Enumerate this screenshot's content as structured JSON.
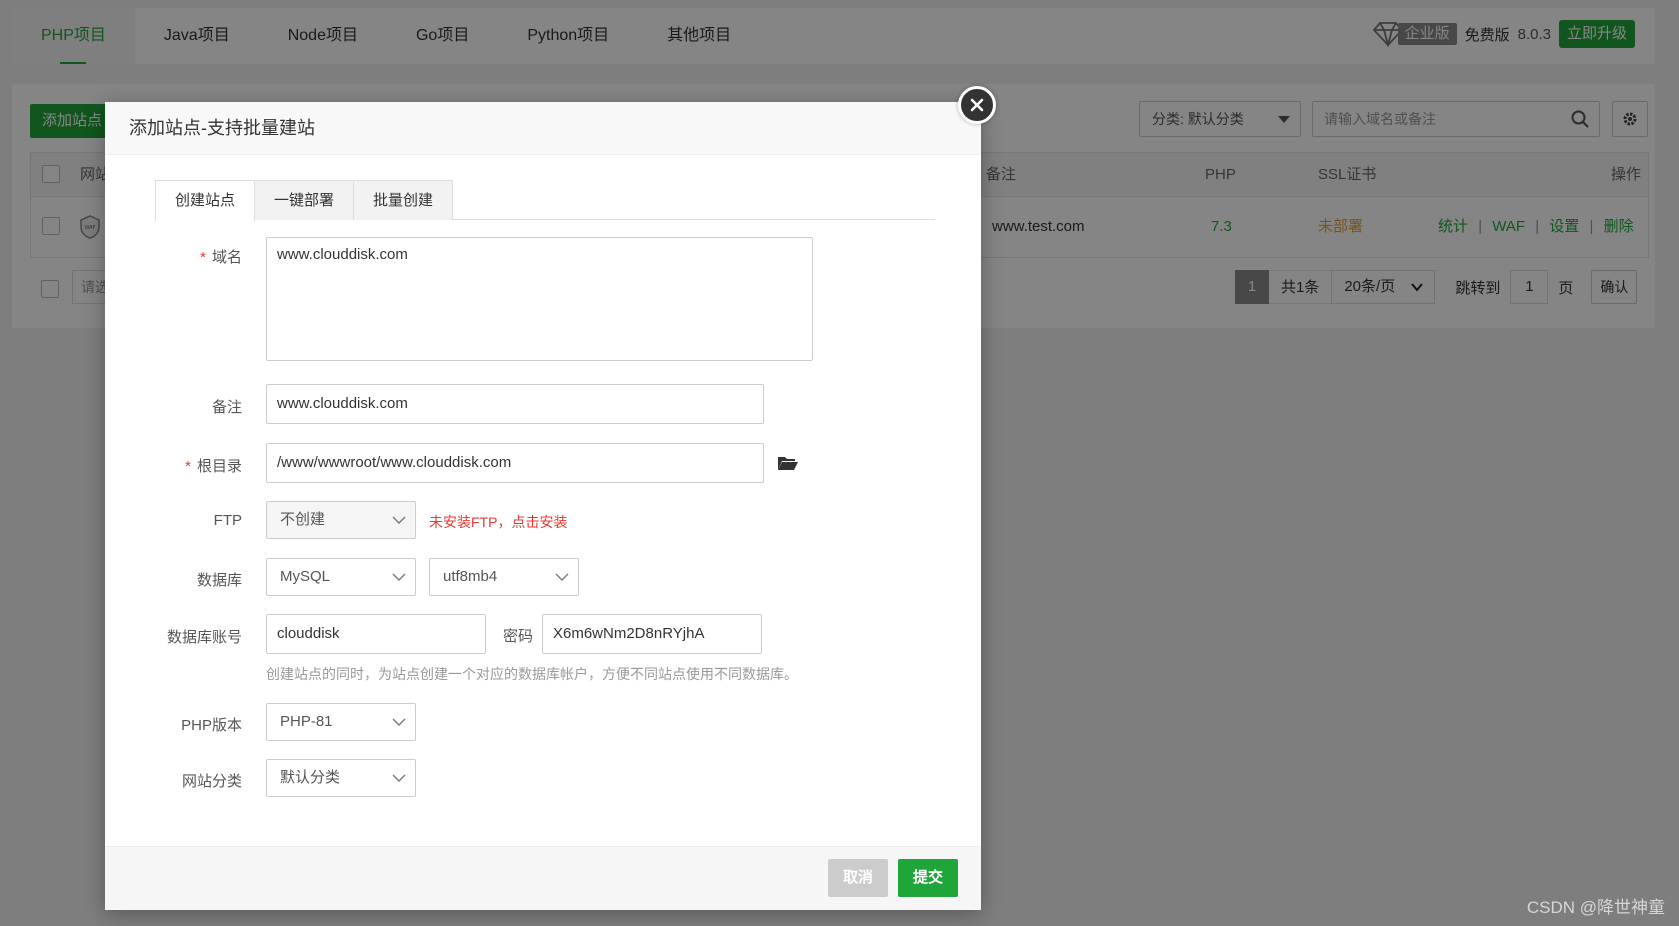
{
  "top_nav": {
    "tabs": [
      "PHP项目",
      "Java项目",
      "Node项目",
      "Go项目",
      "Python项目",
      "其他项目"
    ],
    "active_index": 0,
    "enterprise_label": "企业版",
    "free_label": "免费版",
    "version": "8.0.3",
    "upgrade_label": "立即升级"
  },
  "toolbar": {
    "add_site_label": "添加站点",
    "category_select": "分类: 默认分类",
    "search_placeholder": "请输入域名或备注"
  },
  "table": {
    "headers": {
      "site": "网站",
      "remark": "备注",
      "php": "PHP",
      "ssl": "SSL证书",
      "ops": "操作"
    },
    "rows": [
      {
        "remark": "www.test.com",
        "php": "7.3",
        "ssl": "未部署",
        "ops": [
          "统计",
          "WAF",
          "设置",
          "删除"
        ]
      }
    ],
    "batch_placeholder": "请选"
  },
  "pager": {
    "current": "1",
    "total_text": "共1条",
    "per_page": "20条/页",
    "jump_label": "跳转到",
    "jump_value": "1",
    "page_unit": "页",
    "confirm_label": "确认"
  },
  "modal": {
    "title": "添加站点-支持批量建站",
    "tabs": [
      "创建站点",
      "一键部署",
      "批量创建"
    ],
    "active_tab": 0,
    "fields": {
      "domain_label": "域名",
      "domain_value": "www.clouddisk.com",
      "remark_label": "备注",
      "remark_value": "www.clouddisk.com",
      "root_label": "根目录",
      "root_value": "/www/wwwroot/www.clouddisk.com",
      "ftp_label": "FTP",
      "ftp_value": "不创建",
      "ftp_warning": "未安装FTP，点击安装",
      "db_label": "数据库",
      "db_type": "MySQL",
      "db_charset": "utf8mb4",
      "db_account_label": "数据库账号",
      "db_account_value": "clouddisk",
      "db_password_label": "密码",
      "db_password_value": "X6m6wNm2D8nRYjhA",
      "db_hint": "创建站点的同时，为站点创建一个对应的数据库帐户，方便不同站点使用不同数据库。",
      "php_label": "PHP版本",
      "php_value": "PHP-81",
      "category_label": "网站分类",
      "category_value": "默认分类"
    },
    "cancel_label": "取消",
    "submit_label": "提交"
  },
  "watermark": "CSDN @降世神童",
  "colors": {
    "accent": "#20a53a",
    "warning": "#e53935",
    "ssl_warning": "#e6a23c"
  }
}
